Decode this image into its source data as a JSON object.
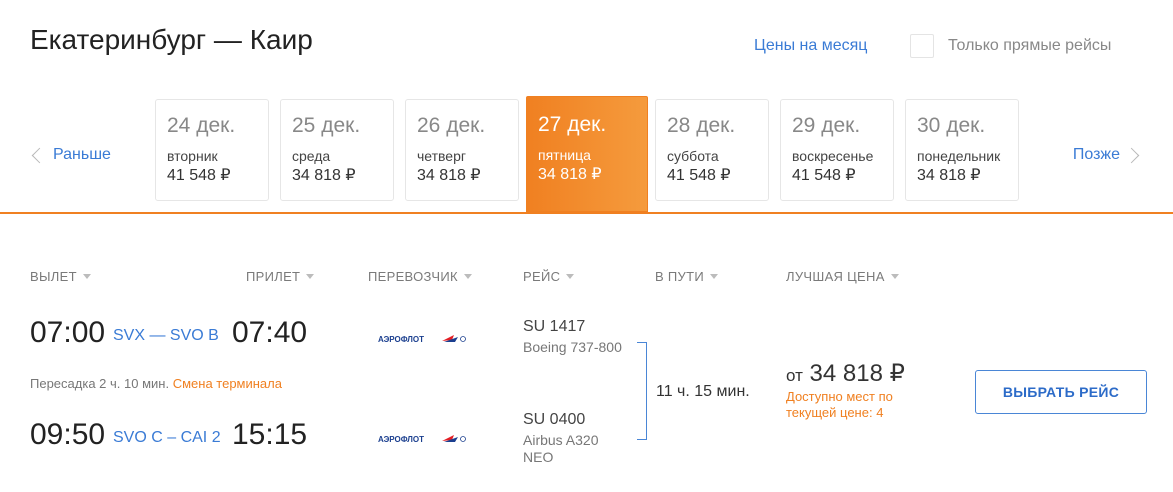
{
  "header": {
    "title": "Екатеринбург — Каир",
    "month_prices_link": "Цены на месяц",
    "direct_only_label": "Только прямые рейсы"
  },
  "date_nav": {
    "prev_label": "Раньше",
    "next_label": "Позже",
    "dates": [
      {
        "date": "24 дек.",
        "weekday": "вторник",
        "price": "41 548 ₽",
        "active": false
      },
      {
        "date": "25 дек.",
        "weekday": "среда",
        "price": "34 818 ₽",
        "active": false
      },
      {
        "date": "26 дек.",
        "weekday": "четверг",
        "price": "34 818 ₽",
        "active": false
      },
      {
        "date": "27 дек.",
        "weekday": "пятница",
        "price": "34 818 ₽",
        "active": true
      },
      {
        "date": "28 дек.",
        "weekday": "суббота",
        "price": "41 548 ₽",
        "active": false
      },
      {
        "date": "29 дек.",
        "weekday": "воскресенье",
        "price": "41 548 ₽",
        "active": false
      },
      {
        "date": "30 дек.",
        "weekday": "понедельник",
        "price": "34 818 ₽",
        "active": false
      }
    ]
  },
  "columns": {
    "departure": "ВЫЛЕТ",
    "arrival": "ПРИЛЕТ",
    "carrier": "ПЕРЕВОЗЧИК",
    "flight": "РЕЙС",
    "duration": "В ПУТИ",
    "best_price": "ЛУЧШАЯ ЦЕНА"
  },
  "result": {
    "segments": [
      {
        "dep_time": "07:00",
        "route": "SVX — SVO B",
        "arr_time": "07:40",
        "airline": "АЭРОФЛОТ",
        "flight_no": "SU 1417",
        "aircraft": "Boeing 737-800"
      },
      {
        "dep_time": "09:50",
        "route": "SVO C – CAI 2",
        "arr_time": "15:15",
        "airline": "АЭРОФЛОТ",
        "flight_no": "SU 0400",
        "aircraft": "Airbus A320 NEO"
      }
    ],
    "transfer_text": "Пересадка 2 ч. 10 мин.",
    "terminal_change": "Смена терминала",
    "duration": "11 ч. 15 мин.",
    "price_prefix": "от",
    "price": "34 818 ₽",
    "availability": "Доступно мест по текущей цене: 4",
    "select_button": "ВЫБРАТЬ РЕЙС"
  },
  "colors": {
    "accent": "#f08021",
    "link": "#3a7bd5"
  }
}
